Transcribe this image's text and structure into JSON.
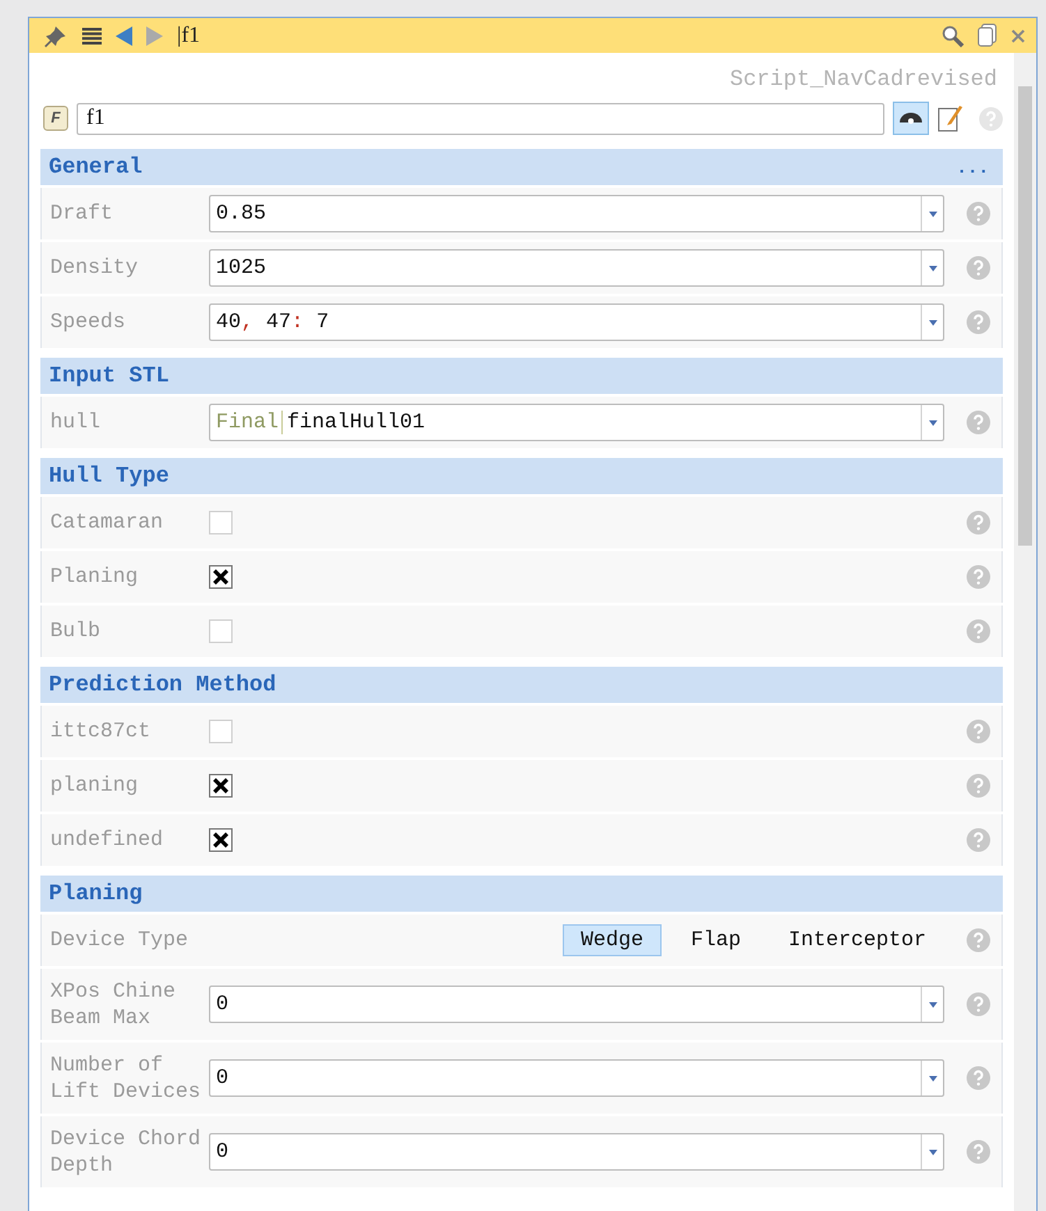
{
  "toolbar": {
    "title": "|f1"
  },
  "script_name": "Script_NavCadrevised",
  "name_field": {
    "badge": "F",
    "value": "f1",
    "view_selected": true
  },
  "sections": [
    {
      "title": "General",
      "more": "...",
      "rows": [
        {
          "kind": "combo",
          "label": "Draft",
          "value": "0.85"
        },
        {
          "kind": "combo",
          "label": "Density",
          "value": "1025"
        },
        {
          "kind": "combo",
          "label": "Speeds",
          "value": "40, 47: 7"
        }
      ]
    },
    {
      "title": "Input STL",
      "rows": [
        {
          "kind": "combo",
          "label": "hull",
          "prefix": "Final",
          "value": "finalHull01"
        }
      ]
    },
    {
      "title": "Hull Type",
      "rows": [
        {
          "kind": "checkbox",
          "label": "Catamaran",
          "checked": false
        },
        {
          "kind": "checkbox",
          "label": "Planing",
          "checked": true
        },
        {
          "kind": "checkbox",
          "label": "Bulb",
          "checked": false
        }
      ]
    },
    {
      "title": "Prediction Method",
      "rows": [
        {
          "kind": "checkbox",
          "label": "ittc87ct",
          "checked": false
        },
        {
          "kind": "checkbox",
          "label": "planing",
          "checked": true
        },
        {
          "kind": "checkbox",
          "label": "undefined",
          "checked": true
        }
      ]
    },
    {
      "title": "Planing",
      "rows": [
        {
          "kind": "segmented",
          "label": "Device Type",
          "options": [
            {
              "label": "Wedge",
              "selected": true
            },
            {
              "label": "Flap",
              "selected": false
            },
            {
              "label": "Interceptor",
              "selected": false
            }
          ]
        },
        {
          "kind": "combo",
          "label": "XPos Chine Beam Max",
          "value": "0"
        },
        {
          "kind": "combo",
          "label": "Number of Lift Devices",
          "value": "0"
        },
        {
          "kind": "combo",
          "label": "Device Chord Depth",
          "value": "0"
        }
      ]
    }
  ]
}
